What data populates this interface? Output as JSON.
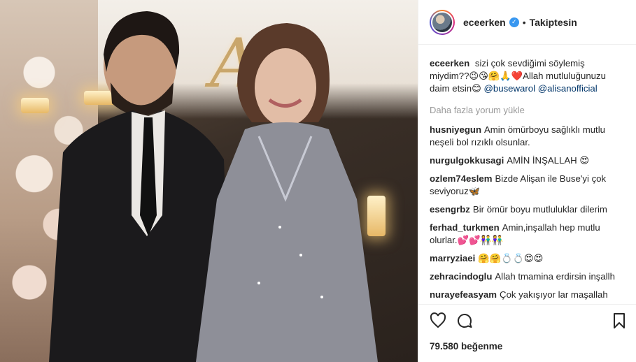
{
  "post": {
    "author": "eceerken",
    "follow_status": "Takiptesin",
    "caption": {
      "user": "eceerken",
      "text": "sizi çok sevdiğimi söylemiş miydim??😉😘🤗🙏❤️Allah mutluluğunuzu daim etsin😊",
      "mentions": [
        "@busewarol",
        "@alisanofficial"
      ]
    },
    "load_more": "Daha fazla yorum yükle",
    "comments": [
      {
        "user": "husniyegun",
        "text": "Amin ömürboyu sağlıklı mutlu neşeli bol rızıklı olsunlar."
      },
      {
        "user": "nurgulgokkusagi",
        "text": "AMİN İNŞALLAH 😍"
      },
      {
        "user": "ozlem74eslem",
        "text": "Bizde Alişan ile Buse'yi çok seviyoruz🦋"
      },
      {
        "user": "esengrbz",
        "text": "Bir ömür boyu mutluluklar dilerim"
      },
      {
        "user": "ferhad_turkmen",
        "text": "Amin,inşallah hep mutlu olurlar.💕💕👫👫"
      },
      {
        "user": "marryziaei",
        "text": "🤗🤗💍💍😍😍"
      },
      {
        "user": "zehracindoglu",
        "text": "Allah tmamina erdirsin inşallh"
      },
      {
        "user": "nurayefeasyam",
        "text": "Çok yakışıyor lar maşallah"
      }
    ],
    "likes": "79.580 beğenme",
    "photo_monogram": "A"
  },
  "icons": {
    "like": "heart-icon",
    "comment": "comment-icon",
    "save": "bookmark-icon",
    "verified": "verified-badge-icon"
  },
  "colors": {
    "verified": "#3897f0",
    "mention": "#003569",
    "muted": "#999999"
  }
}
